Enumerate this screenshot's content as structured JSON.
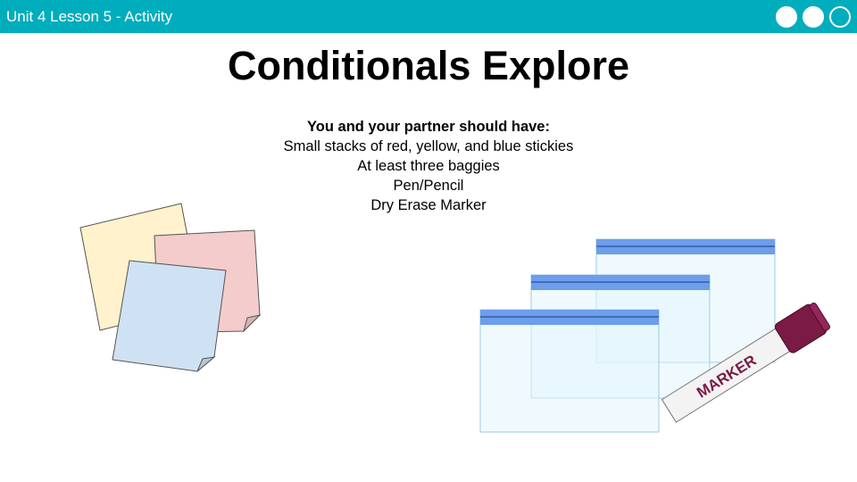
{
  "header": {
    "lesson_label": "Unit 4 Lesson 5 - Activity",
    "progress": {
      "filled": 2,
      "total": 3
    }
  },
  "slide": {
    "title": "Conditionals Explore",
    "materials_heading": "You and your partner should have:",
    "materials": [
      "Small stacks of red, yellow, and blue stickies",
      "At least three baggies",
      "Pen/Pencil",
      "Dry Erase Marker"
    ]
  },
  "illustrations": {
    "marker_label": "MARKER",
    "sticky_colors": {
      "yellow": "#fff2cc",
      "red": "#f4cccc",
      "blue": "#cfe2f3"
    },
    "baggie_fill": "#e3f6fd",
    "baggie_seal": "#6d9eeb",
    "marker_cap": "#7b1a45"
  },
  "colors": {
    "header_bar": "#00adbc"
  }
}
